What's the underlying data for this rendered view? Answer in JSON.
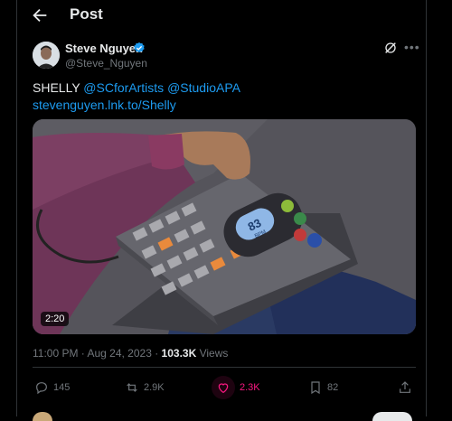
{
  "header": {
    "title": "Post",
    "back_icon": "arrow-left-icon"
  },
  "author": {
    "name": "Steve Nguyen",
    "handle": "@Steve_Nguyen",
    "verified_icon": "verified-badge-icon",
    "verified_color": "#1d9bf0"
  },
  "post": {
    "text_plain": "SHELLY ",
    "mention1": "@SCforArtists",
    "mention2": "@StudioAPA",
    "link": "stevenguyen.lnk.to/Shelly",
    "video_duration": "2:20"
  },
  "device_display": {
    "bpm_value": "83",
    "bpm_label": "BPM"
  },
  "meta": {
    "time": "11:00 PM · Aug 24, 2023 · ",
    "views_count": "103.3K",
    "views_label": " Views"
  },
  "actions": {
    "replies": "145",
    "reposts": "2.9K",
    "likes": "2.3K",
    "bookmarks": "82"
  },
  "colors": {
    "accent": "#1d9bf0",
    "like": "#f91880",
    "muted": "#71767b",
    "text": "#e7e9ea"
  }
}
